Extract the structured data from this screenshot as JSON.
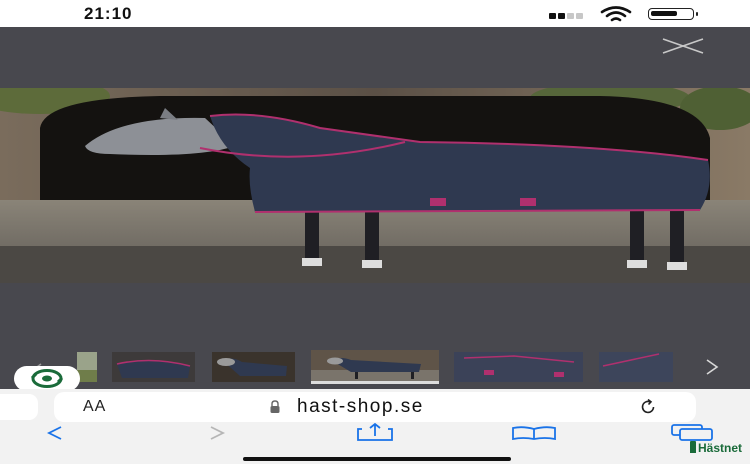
{
  "status_bar": {
    "time": "21:10",
    "icons": [
      "cellular-signal-icon",
      "wifi-icon",
      "battery-icon"
    ]
  },
  "viewer": {
    "close_icon": "close-icon",
    "prev_icon": "chevron-left-icon",
    "next_icon": "chevron-right-icon",
    "thumbnail_count": 6,
    "selected_thumbnail": 3
  },
  "browser": {
    "text_size_label": "AA",
    "url": "hast-shop.se",
    "lock_icon": "lock-icon",
    "reload_icon": "reload-icon"
  },
  "toolbar": {
    "icons": [
      "back-icon",
      "forward-icon",
      "share-icon",
      "bookmarks-icon",
      "tabs-icon"
    ]
  },
  "brand": {
    "name": "Hästnet"
  },
  "colors": {
    "blanket_navy": "#2f3950",
    "blanket_trim": "#b0306e",
    "viewer_background": "#48484e",
    "link_blue": "#1a73e8"
  }
}
